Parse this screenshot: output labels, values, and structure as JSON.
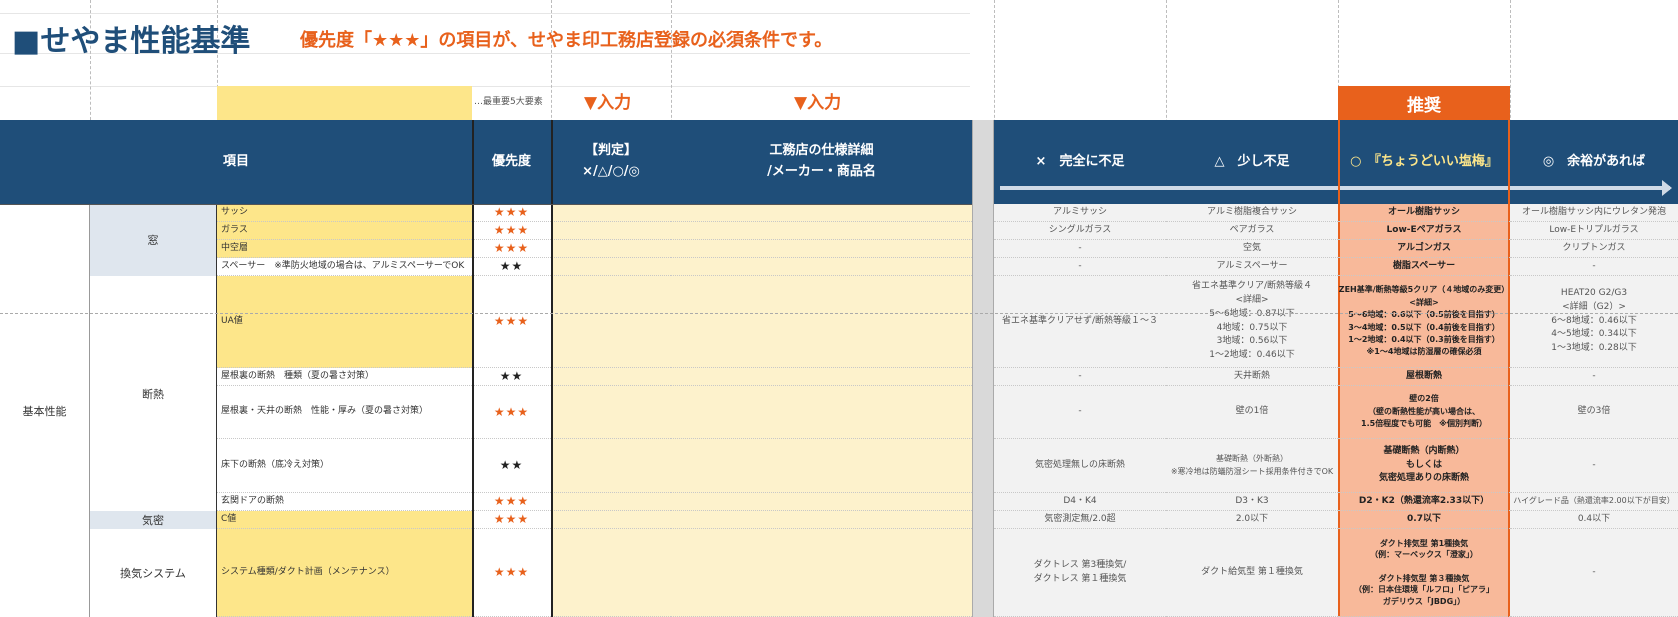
{
  "title": "■せやま性能基準",
  "subtitle": "優先度「★★★」の項目が、せやま印工務店登録の必須条件です。",
  "note": "…最重要5大要素",
  "input_label": "▼入力",
  "recommended": "推奨",
  "headers": {
    "item": "項目",
    "priority": "優先度",
    "judge": "【判定】\n×/△/○/◎",
    "spec": "工務店の仕様詳細\n/メーカー・商品名",
    "x": "×　完全に不足",
    "tri": "△　少し不足",
    "circle": "○　『ちょうどいい塩梅』",
    "double": "◎　余裕があれば"
  },
  "categories": {
    "basic": "基本性能",
    "window": "窓",
    "insulation": "断熱",
    "airtight": "気密",
    "ventilation": "換気システム"
  },
  "rows": [
    {
      "item": "サッシ",
      "priority": "★★★",
      "x": "アルミサッシ",
      "tri": "アルミ樹脂複合サッシ",
      "circle": "オール樹脂サッシ",
      "double": "オール樹脂サッシ内にウレタン発泡"
    },
    {
      "item": "ガラス",
      "priority": "★★★",
      "x": "シングルガラス",
      "tri": "ペアガラス",
      "circle": "Low-Eペアガラス",
      "double": "Low-Eトリプルガラス"
    },
    {
      "item": "中空層",
      "priority": "★★★",
      "x": "-",
      "tri": "空気",
      "circle": "アルゴンガス",
      "double": "クリプトンガス"
    },
    {
      "item": "スペーサー　※準防火地域の場合は、アルミスペーサーでOK",
      "priority": "★★",
      "x": "-",
      "tri": "アルミスペーサー",
      "circle": "樹脂スペーサー",
      "double": "-"
    },
    {
      "item": "UA値",
      "priority": "★★★",
      "x": "省エネ基準クリアせず/断熱等級１～３",
      "tri": "省エネ基準クリア/断熱等級４\n<詳細>\n5～6地域：0.87以下\n4地域：0.75以下\n3地域：0.56以下\n1～2地域：0.46以下",
      "circle": "ZEH基準/断熱等級5クリア（４地域のみ変更）\n<詳細>\n5～6地域：0.6以下（0.5前後を目指す）\n3～4地域：0.5以下（0.4前後を目指す）\n1～2地域：0.4以下（0.3前後を目指す）\n※1～4地域は防湿層の確保必須",
      "double": "HEAT20 G2/G3\n<詳細（G2）>\n6～8地域：0.46以下\n4～5地域：0.34以下\n1～3地域：0.28以下"
    },
    {
      "item": "屋根裏の断熱　種類（夏の暑さ対策）",
      "priority": "★★",
      "x": "-",
      "tri": "天井断熱",
      "circle": "屋根断熱",
      "double": "-"
    },
    {
      "item": "屋根裏・天井の断熱　性能・厚み（夏の暑さ対策）",
      "priority": "★★★",
      "x": "-",
      "tri": "壁の1倍",
      "circle": "壁の2倍\n（壁の断熱性能が高い場合は、\n1.5倍程度でも可能　※個別判断）",
      "double": "壁の3倍"
    },
    {
      "item": "床下の断熱（底冷え対策）",
      "priority": "★★",
      "x": "気密処理無しの床断熱",
      "tri": "基礎断熱（外断熱）\n※寒冷地は防蟻防湿シート採用条件付きでOK",
      "circle": "基礎断熱（内断熱）\nもしくは\n気密処理ありの床断熱",
      "double": "-"
    },
    {
      "item": "玄関ドアの断熱",
      "priority": "★★★",
      "x": "D4・K4",
      "tri": "D3・K3",
      "circle": "D2・K2（熱還流率2.33以下）",
      "double": "ハイグレード品（熱還流率2.00以下が目安）"
    },
    {
      "item": "C値",
      "priority": "★★★",
      "x": "気密測定無/2.0超",
      "tri": "2.0以下",
      "circle": "0.7以下",
      "double": "0.4以下"
    },
    {
      "item": "システム種類/ダクト計画（メンテナンス）",
      "priority": "★★★",
      "x": "ダクトレス 第3種換気/\nダクトレス 第１種換気",
      "tri": "ダクト給気型 第１種換気",
      "circle": "ダクト排気型 第1種換気\n（例：マーベックス「澄家」）\n\nダクト排気型 第３種換気\n（例：日本住環境「ルフロ」「ピアラ」\nガデリウス「JBDG」）",
      "double": "-"
    }
  ],
  "colors": {
    "header": "#1f4e79",
    "accent": "#e8611c",
    "recommended_fill": "#f8b99a",
    "input_fill": "#fdf2cc",
    "priority_fill": "#fde68a"
  }
}
